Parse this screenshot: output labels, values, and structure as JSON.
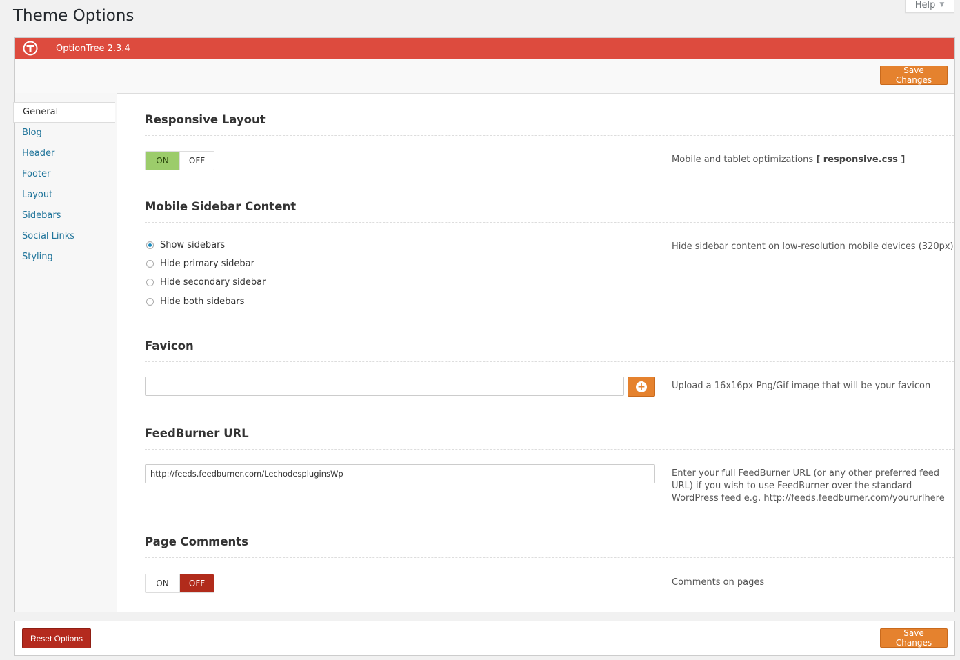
{
  "page": {
    "title": "Theme Options",
    "help_label": "Help"
  },
  "header": {
    "version_label": "OptionTree 2.3.4",
    "logo_icon": "optiontree-logo-icon"
  },
  "toolbar": {
    "save_label": "Save Changes"
  },
  "nav": {
    "items": [
      {
        "label": "General",
        "active": true
      },
      {
        "label": "Blog"
      },
      {
        "label": "Header"
      },
      {
        "label": "Footer"
      },
      {
        "label": "Layout"
      },
      {
        "label": "Sidebars"
      },
      {
        "label": "Social Links"
      },
      {
        "label": "Styling"
      }
    ]
  },
  "sections": {
    "responsive": {
      "title": "Responsive Layout",
      "on_label": "ON",
      "off_label": "OFF",
      "value": "ON",
      "desc_prefix": "Mobile and tablet optimizations ",
      "desc_bold": "[ responsive.css ]"
    },
    "mobile_sidebar": {
      "title": "Mobile Sidebar Content",
      "options": [
        "Show sidebars",
        "Hide primary sidebar",
        "Hide secondary sidebar",
        "Hide both sidebars"
      ],
      "selected": "Show sidebars",
      "desc": "Hide sidebar content on low-resolution mobile devices (320px)"
    },
    "favicon": {
      "title": "Favicon",
      "value": "",
      "desc": "Upload a 16x16px Png/Gif image that will be your favicon"
    },
    "feedburner": {
      "title": "FeedBurner URL",
      "value": "http://feeds.feedburner.com/LechodespluginsWp",
      "desc": "Enter your full FeedBurner URL (or any other preferred feed URL) if you wish to use FeedBurner over the standard WordPress feed e.g. http://feeds.feedburner.com/yoururlhere"
    },
    "page_comments": {
      "title": "Page Comments",
      "on_label": "ON",
      "off_label": "OFF",
      "value": "OFF",
      "desc": "Comments on pages"
    }
  },
  "footer": {
    "reset_label": "Reset Options",
    "save_label": "Save Changes"
  },
  "colors": {
    "header_red": "#dd4b3e",
    "save_orange": "#e5822e",
    "reset_red": "#b42a1e",
    "on_green": "#9ccc6b",
    "off_red": "#b12b1b"
  }
}
